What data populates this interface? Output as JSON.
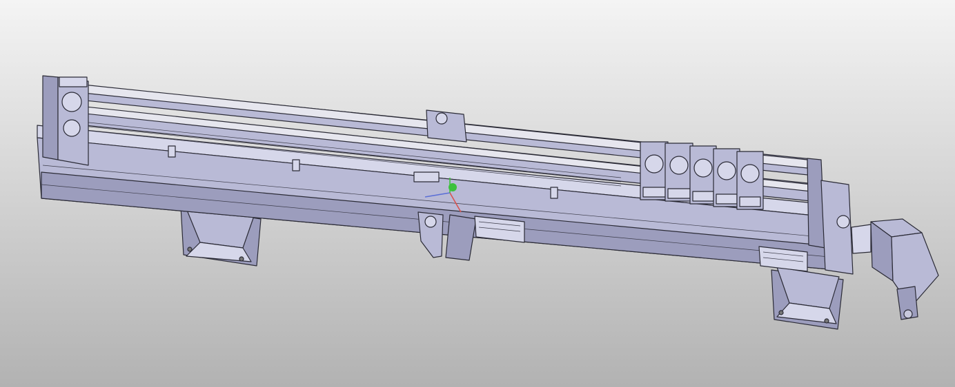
{
  "viewport": {
    "background_top": "#f4f4f4",
    "background_bottom": "#b2b2b2"
  },
  "model": {
    "part_color": "#b9bad6",
    "part_shade": "#9c9dbd",
    "part_light": "#d6d7ea",
    "edge_color": "#2a2a35",
    "rail_color": "#e6e6ee"
  },
  "triad": {
    "x_axis_color": "#d9534f",
    "y_axis_color": "#3cc13c",
    "z_axis_color": "#5b6fd6"
  }
}
